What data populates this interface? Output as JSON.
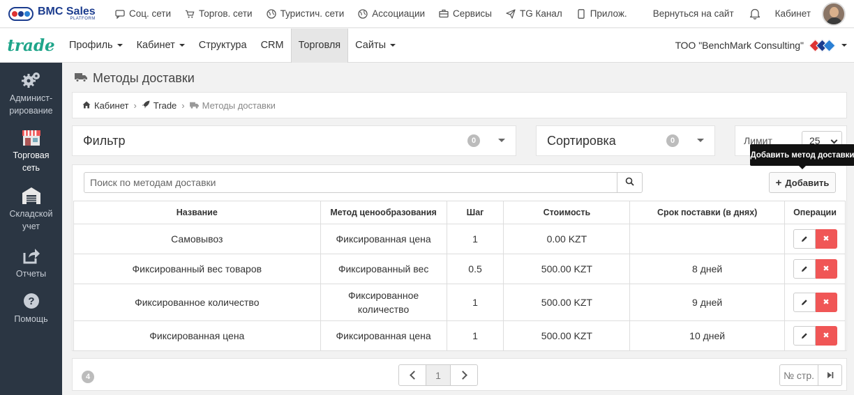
{
  "topbar": {
    "logo_text": "BMC Sales",
    "logo_sub": "PLATFORM",
    "nav": [
      {
        "label": "Соц. сети",
        "icon": "chat-bubble-icon"
      },
      {
        "label": "Торгов. сети",
        "icon": "cart-icon"
      },
      {
        "label": "Туристич. сети",
        "icon": "globe-icon"
      },
      {
        "label": "Ассоциации",
        "icon": "globe-icon"
      },
      {
        "label": "Сервисы",
        "icon": "briefcase-icon"
      },
      {
        "label": "TG Канал",
        "icon": "paper-plane-icon"
      },
      {
        "label": "Прилож.",
        "icon": "mobile-icon"
      }
    ],
    "back_to_site": "Вернуться на сайт",
    "cabinet": "Кабинет"
  },
  "secondbar": {
    "brand": "trade",
    "menu": [
      {
        "label": "Профиль",
        "dropdown": true
      },
      {
        "label": "Кабинет",
        "dropdown": true
      },
      {
        "label": "Структура",
        "dropdown": false
      },
      {
        "label": "CRM",
        "dropdown": false
      },
      {
        "label": "Торговля",
        "dropdown": false,
        "active": true
      },
      {
        "label": "Сайты",
        "dropdown": true
      }
    ],
    "company": "ТОО \"BenchMark Consulting\""
  },
  "sidebar": {
    "items": [
      {
        "label": "Админист-\nрирование",
        "icon": "gears-icon"
      },
      {
        "label": "Торговая\nсеть",
        "icon": "shop-icon",
        "active": true
      },
      {
        "label": "Складской\nучет",
        "icon": "warehouse-icon"
      },
      {
        "label": "Отчеты",
        "icon": "share-icon"
      },
      {
        "label": "Помощь",
        "icon": "question-icon"
      }
    ]
  },
  "page": {
    "title": "Методы доставки",
    "breadcrumb": [
      "Кабинет",
      "Trade",
      "Методы доставки"
    ]
  },
  "filter": {
    "title": "Фильтр",
    "count": "0"
  },
  "sort": {
    "title": "Сортировка",
    "count": "0"
  },
  "limit": {
    "label": "Лимит",
    "value": "25"
  },
  "tooltip": "Добавить метод доставки",
  "search": {
    "placeholder": "Поиск по методам доставки",
    "value": ""
  },
  "add_button": "Добавить",
  "table": {
    "columns": [
      "Название",
      "Метод ценообразования",
      "Шаг",
      "Стоимость",
      "Срок поставки (в днях)",
      "Операции"
    ],
    "rows": [
      {
        "name": "Самовывоз",
        "method": "Фиксированная цена",
        "step": "1",
        "cost": "0.00 KZT",
        "term": ""
      },
      {
        "name": "Фиксированный вес товаров",
        "method": "Фиксированный вес",
        "step": "0.5",
        "cost": "500.00 KZT",
        "term": "8 дней"
      },
      {
        "name": "Фиксированное количество",
        "method": "Фиксированное количество",
        "step": "1",
        "cost": "500.00 KZT",
        "term": "9 дней"
      },
      {
        "name": "Фиксированная цена",
        "method": "Фиксированная цена",
        "step": "1",
        "cost": "500.00 KZT",
        "term": "10 дней"
      }
    ]
  },
  "footer": {
    "total": "4",
    "current_page": "1",
    "page_jump_label": "№ стр."
  },
  "colors": {
    "sidebar_bg": "#2b3643",
    "brand": "#1fa58a",
    "delete": "#f05656",
    "logo_blue": "#1b3c8e"
  }
}
